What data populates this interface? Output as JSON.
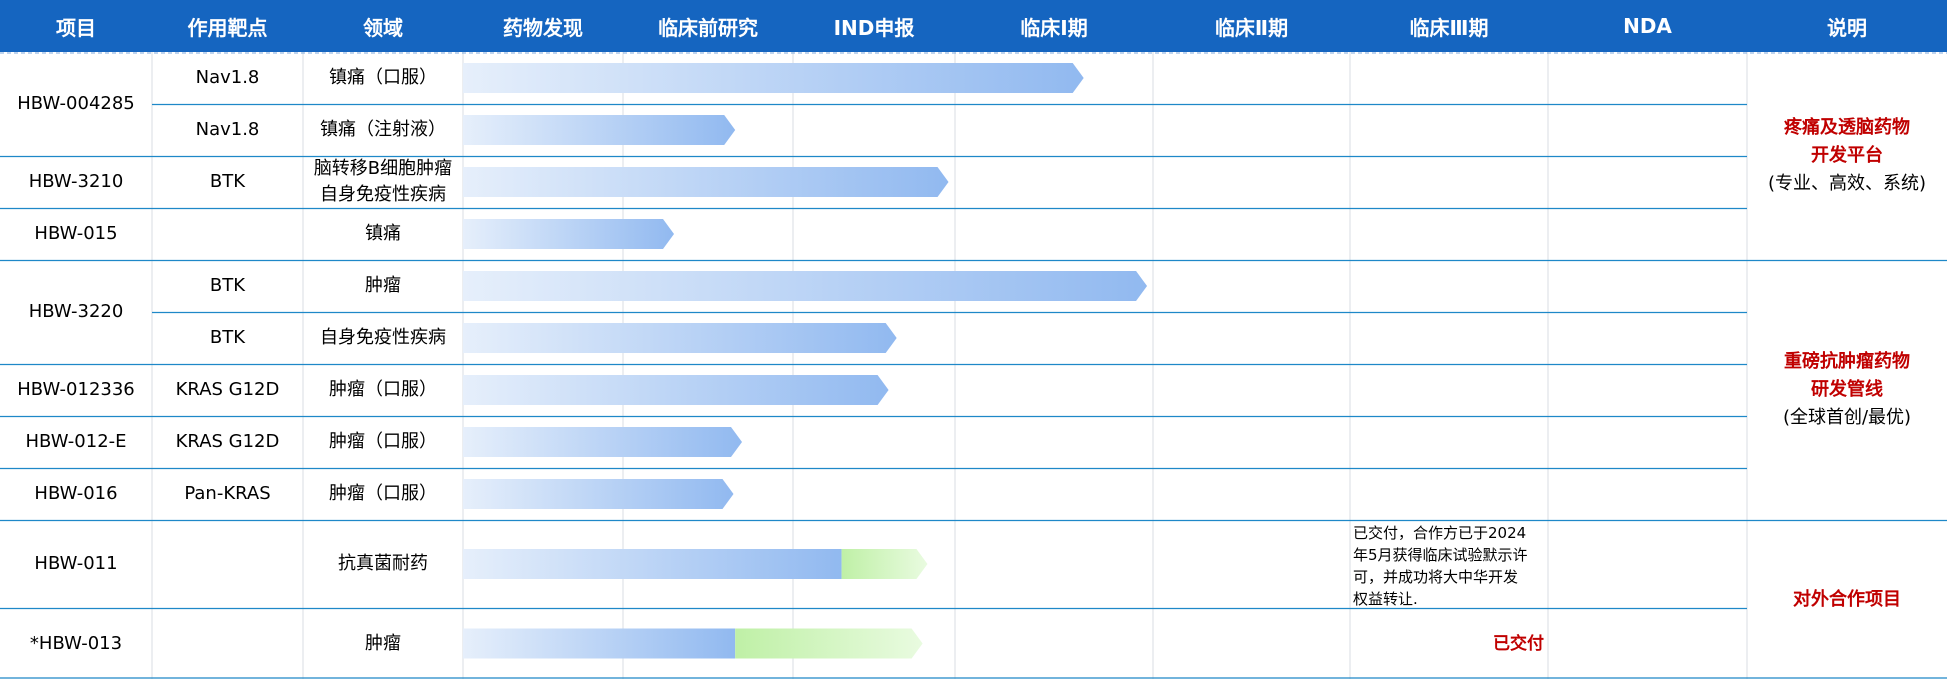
{
  "colors": {
    "header_bg": "#1565c0",
    "row_line": "#1e88c8",
    "grid_line": "#d8dde3",
    "bar_blue_start": "#e6effb",
    "bar_blue_end": "#91b9f0",
    "bar_green_start": "#bff0a6",
    "bar_green_end": "#e9fbe0",
    "accent_red": "#c00000"
  },
  "header": [
    "项目",
    "作用靶点",
    "领域",
    "药物发现",
    "临床前研究",
    "IND申报",
    "临床Ⅰ期",
    "临床Ⅱ期",
    "临床Ⅲ期",
    "NDA",
    "说明"
  ],
  "rows": [
    {
      "target": "Nav1.8",
      "area": "镇痛（口服）"
    },
    {
      "target": "Nav1.8",
      "area": "镇痛（注射液）"
    },
    {
      "target": "BTK",
      "area": "脑转移B细胞肿瘤\n自身免疫性疾病"
    },
    {
      "target": "",
      "area": "镇痛"
    },
    {
      "target": "BTK",
      "area": "肿瘤"
    },
    {
      "target": "BTK",
      "area": "自身免疫性疾病"
    },
    {
      "target": "KRAS G12D",
      "area": "肿瘤（口服）"
    },
    {
      "target": "KRAS G12D",
      "area": "肿瘤（口服）"
    },
    {
      "target": "Pan-KRAS",
      "area": "肿瘤（口服）"
    },
    {
      "target": "",
      "area": "抗真菌耐药"
    },
    {
      "target": "",
      "area": "肿瘤"
    }
  ],
  "projects": [
    {
      "name": "HBW-004285",
      "rows": [
        0,
        1
      ]
    },
    {
      "name": "HBW-3210",
      "rows": [
        2,
        2
      ]
    },
    {
      "name": "HBW-015",
      "rows": [
        3,
        3
      ]
    },
    {
      "name": "HBW-3220",
      "rows": [
        4,
        5
      ]
    },
    {
      "name": "HBW-012336",
      "rows": [
        6,
        6
      ]
    },
    {
      "name": "HBW-012-E",
      "rows": [
        7,
        7
      ]
    },
    {
      "name": "HBW-016",
      "rows": [
        8,
        8
      ]
    },
    {
      "name": "HBW-011",
      "rows": [
        9,
        9
      ]
    },
    {
      "name": "*HBW-013",
      "rows": [
        10,
        10
      ]
    }
  ],
  "descriptions": [
    {
      "rows": [
        0,
        3
      ],
      "lines": [
        "疼痛及透脑药物",
        "开发平台",
        "(专业、高效、系统)"
      ],
      "bold_lines": 2
    },
    {
      "rows": [
        4,
        8
      ],
      "lines": [
        "重磅抗肿瘤药物",
        "研发管线",
        "(全球首创/最优)"
      ],
      "bold_lines": 2
    },
    {
      "rows": [
        9,
        10
      ],
      "lines": [
        "对外合作项目"
      ],
      "bold_lines": 1
    }
  ],
  "chart_data": {
    "type": "bar",
    "x_stages": [
      "药物发现",
      "临床前研究",
      "IND申报",
      "临床Ⅰ期",
      "临床Ⅱ期",
      "临床Ⅲ期",
      "NDA"
    ],
    "x_unit": "stages completed (0 = start of 药物发现, 7 = end of NDA)",
    "bars": [
      {
        "row": 0,
        "end": 3.65
      },
      {
        "row": 1,
        "end": 1.66
      },
      {
        "row": 2,
        "end": 2.96
      },
      {
        "row": 3,
        "end": 1.3
      },
      {
        "row": 4,
        "end": 3.97
      },
      {
        "row": 5,
        "end": 2.64
      },
      {
        "row": 6,
        "end": 2.59
      },
      {
        "row": 7,
        "end": 1.7
      },
      {
        "row": 8,
        "end": 1.65
      },
      {
        "row": 9,
        "end": 2.83,
        "partner_from": 2.3
      },
      {
        "row": 10,
        "end": 2.8,
        "partner_from": 1.66
      }
    ],
    "annotations": [
      {
        "row": 9,
        "lines": [
          "已交付，合作方已于2024",
          "年5月获得临床试验默示许",
          "可，并成功将大中华开发",
          "权益转让."
        ]
      },
      {
        "row": 10,
        "lines": [
          "已交付"
        ],
        "accent": true
      }
    ]
  }
}
